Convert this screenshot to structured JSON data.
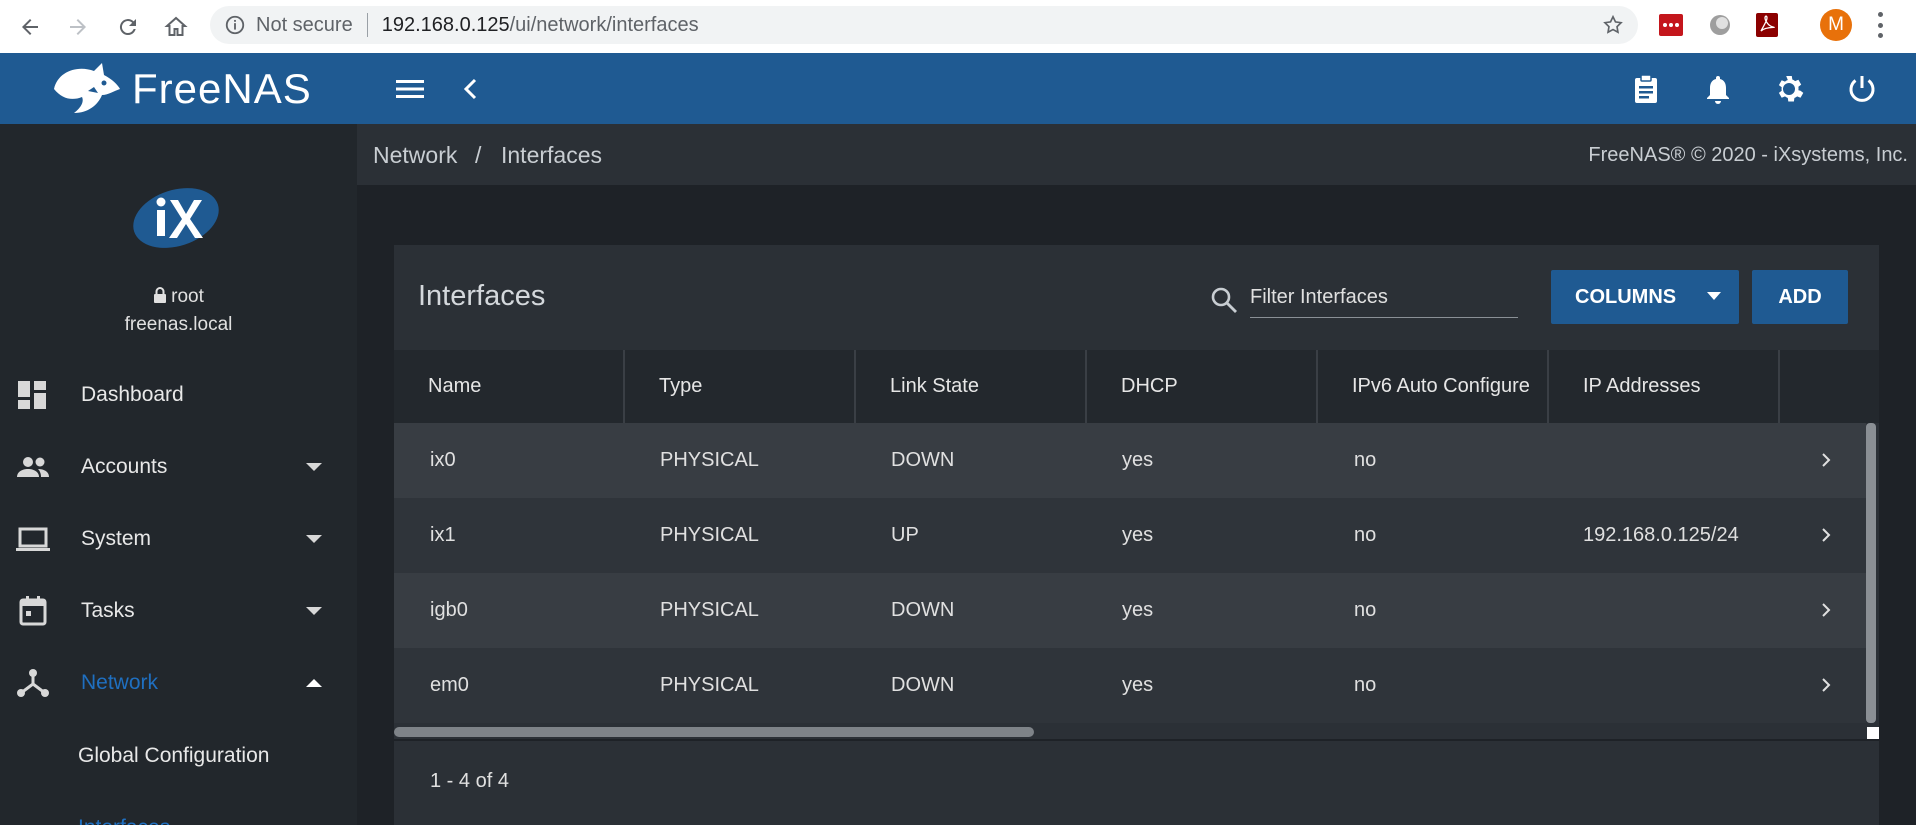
{
  "browser": {
    "not_secure": "Not secure",
    "url_host": "192.168.0.125",
    "url_path": "/ui/network/interfaces",
    "profile_initial": "M",
    "colors": {
      "profile": "#e8710a"
    }
  },
  "app": {
    "logo_text": "FreeNAS",
    "colors": {
      "brand": "#1f5a92",
      "sidebar": "#22272c"
    }
  },
  "user": {
    "name": "root",
    "host": "freenas.local"
  },
  "sidebar": {
    "items": [
      {
        "label": "Dashboard",
        "icon": "dashboard-icon"
      },
      {
        "label": "Accounts",
        "icon": "people-icon"
      },
      {
        "label": "System",
        "icon": "laptop-icon"
      },
      {
        "label": "Tasks",
        "icon": "calendar-icon"
      },
      {
        "label": "Network",
        "icon": "network-icon",
        "active": true
      }
    ],
    "sub_items": [
      {
        "label": "Global Configuration"
      },
      {
        "label": "Interfaces"
      }
    ]
  },
  "breadcrumb": {
    "parent": "Network",
    "separator": "/",
    "current": "Interfaces",
    "copyright": "FreeNAS® © 2020 - iXsystems, Inc."
  },
  "card": {
    "title": "Interfaces",
    "filter_placeholder": "Filter Interfaces",
    "columns_label": "COLUMNS",
    "add_label": "ADD"
  },
  "table": {
    "headers": [
      "Name",
      "Type",
      "Link State",
      "DHCP",
      "IPv6 Auto Configure",
      "IP Addresses"
    ],
    "rows": [
      [
        "ix0",
        "PHYSICAL",
        "DOWN",
        "yes",
        "no",
        ""
      ],
      [
        "ix1",
        "PHYSICAL",
        "UP",
        "yes",
        "no",
        "192.168.0.125/24"
      ],
      [
        "igb0",
        "PHYSICAL",
        "DOWN",
        "yes",
        "no",
        ""
      ],
      [
        "em0",
        "PHYSICAL",
        "DOWN",
        "yes",
        "no",
        ""
      ]
    ],
    "pager": "1 - 4 of 4"
  }
}
